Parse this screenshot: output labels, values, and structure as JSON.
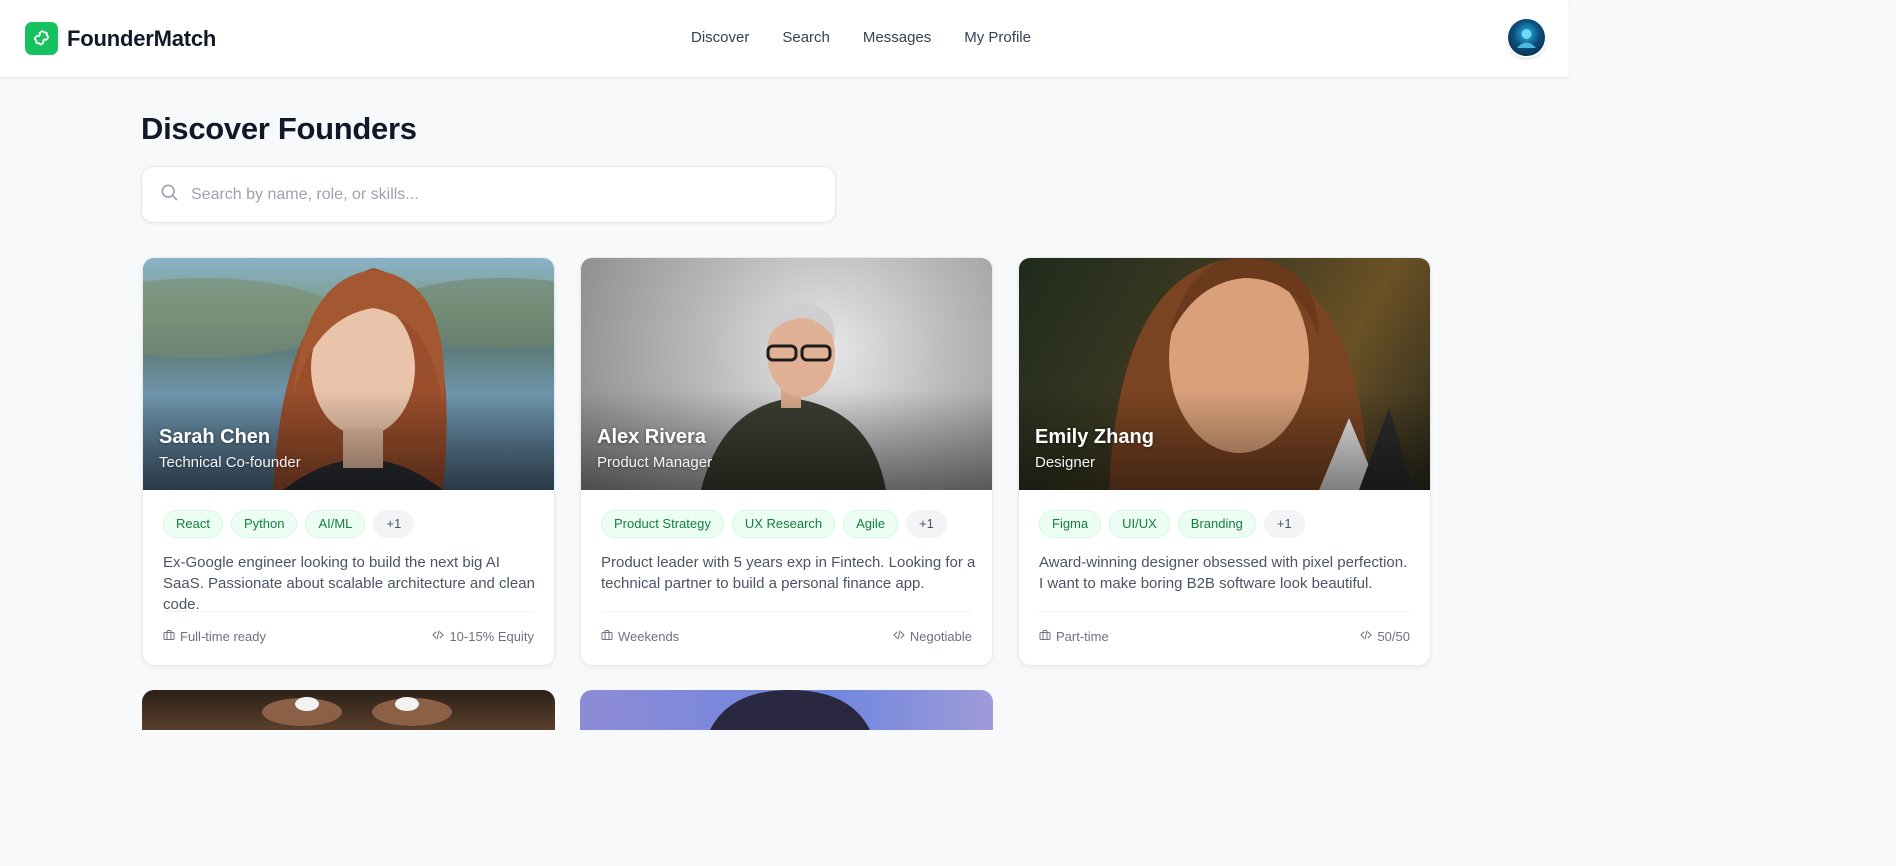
{
  "app": {
    "brand": "FounderMatch",
    "logo_icon": "puzzle-icon",
    "avatar_icon": "user-avatar"
  },
  "nav": {
    "items": [
      "Discover",
      "Search",
      "Messages",
      "My Profile"
    ]
  },
  "page": {
    "title": "Discover Founders"
  },
  "search": {
    "placeholder": "Search by name, role, or skills...",
    "icon": "search-icon"
  },
  "colors": {
    "brand": "#16c25f",
    "tag_text": "#15803d",
    "tag_bg": "#ecfdf3"
  },
  "founders": [
    {
      "name": "Sarah Chen",
      "role": "Technical Co-founder",
      "tags": [
        "React",
        "Python",
        "AI/ML"
      ],
      "more": "+1",
      "bio": "Ex-Google engineer looking to build the next big AI SaaS. Passionate about scalable architecture and clean code.",
      "availability": "Full-time ready",
      "equity": "10-15% Equity"
    },
    {
      "name": "Alex Rivera",
      "role": "Product Manager",
      "tags": [
        "Product Strategy",
        "UX Research",
        "Agile"
      ],
      "more": "+1",
      "bio": "Product leader with 5 years exp in Fintech. Looking for a technical partner to build a personal finance app.",
      "availability": "Weekends",
      "equity": "Negotiable"
    },
    {
      "name": "Emily Zhang",
      "role": "Designer",
      "tags": [
        "Figma",
        "UI/UX",
        "Branding"
      ],
      "more": "+1",
      "bio": "Award-winning designer obsessed with pixel perfection. I want to make boring B2B software look beautiful.",
      "availability": "Part-time",
      "equity": "50/50"
    }
  ]
}
